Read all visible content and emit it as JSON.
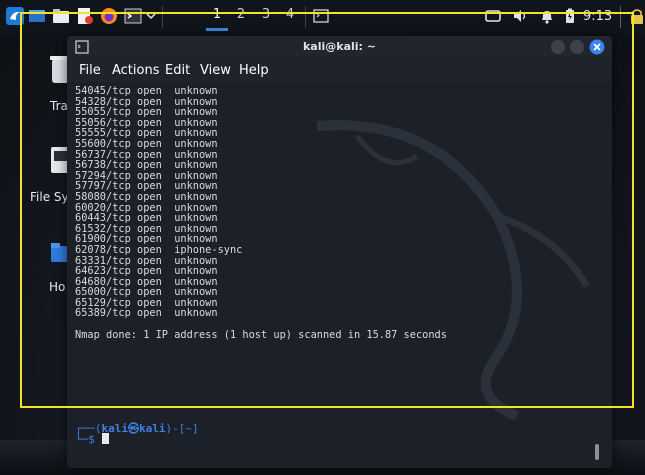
{
  "taskbar": {
    "workspaces": [
      "1",
      "2",
      "3",
      "4"
    ],
    "active_workspace": "1",
    "clock": "9:13",
    "icons": [
      "kali-menu-icon",
      "desktop-icon",
      "file-manager-icon",
      "text-editor-icon",
      "firefox-icon",
      "terminal-icon",
      "chevron-down-icon",
      "window-icon",
      "display-icon",
      "volume-icon",
      "notification-bell-icon",
      "battery-icon",
      "lock-icon"
    ]
  },
  "desktop": {
    "icons": [
      {
        "name": "trash-icon",
        "label": "Tra"
      },
      {
        "name": "file-system-icon",
        "label": "File Sy"
      },
      {
        "name": "home-folder-icon",
        "label": "Ho"
      }
    ]
  },
  "terminal": {
    "title": "kali@kali: ~",
    "menu": [
      "File",
      "Actions",
      "Edit",
      "View",
      "Help"
    ],
    "lines": [
      "54045/tcp open  unknown",
      "54328/tcp open  unknown",
      "55055/tcp open  unknown",
      "55056/tcp open  unknown",
      "55555/tcp open  unknown",
      "55600/tcp open  unknown",
      "56737/tcp open  unknown",
      "56738/tcp open  unknown",
      "57294/tcp open  unknown",
      "57797/tcp open  unknown",
      "58080/tcp open  unknown",
      "60020/tcp open  unknown",
      "60443/tcp open  unknown",
      "61532/tcp open  unknown",
      "61900/tcp open  unknown",
      "62078/tcp open  iphone-sync",
      "63331/tcp open  unknown",
      "64623/tcp open  unknown",
      "64680/tcp open  unknown",
      "65000/tcp open  unknown",
      "65129/tcp open  unknown",
      "65389/tcp open  unknown",
      "",
      "Nmap done: 1 IP address (1 host up) scanned in 15.87 seconds"
    ],
    "prompt": {
      "open": "┌──(",
      "user_host": "kali㉿kali",
      "path_part": ")-[~]",
      "second": "└─$"
    }
  },
  "colors": {
    "accent": "#3c8dde",
    "highlight_frame": "#f3e325",
    "prompt_blue": "#3f7fe0",
    "close_button": "#3a82f0"
  }
}
